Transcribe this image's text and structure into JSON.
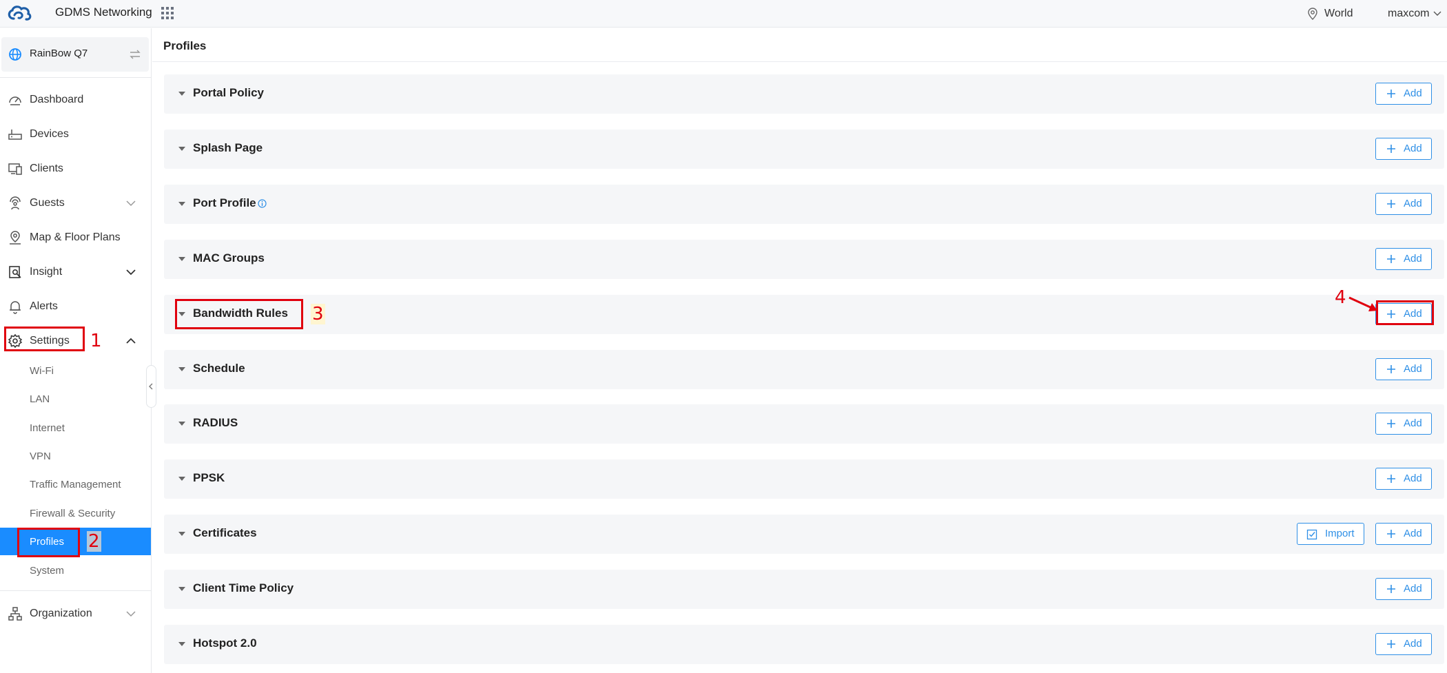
{
  "header": {
    "app_title": "GDMS Networking",
    "location": "World",
    "user": "maxcom"
  },
  "sidebar": {
    "site_name": "RainBow Q7",
    "items": [
      {
        "label": "Dashboard"
      },
      {
        "label": "Devices"
      },
      {
        "label": "Clients"
      },
      {
        "label": "Guests"
      },
      {
        "label": "Map & Floor Plans"
      },
      {
        "label": "Insight"
      },
      {
        "label": "Alerts"
      },
      {
        "label": "Settings"
      },
      {
        "label": "Organization"
      }
    ],
    "settings_sub": [
      {
        "label": "Wi-Fi"
      },
      {
        "label": "LAN"
      },
      {
        "label": "Internet"
      },
      {
        "label": "VPN"
      },
      {
        "label": "Traffic Management"
      },
      {
        "label": "Firewall & Security"
      },
      {
        "label": "Profiles"
      },
      {
        "label": "System"
      }
    ]
  },
  "main": {
    "title": "Profiles",
    "add_label": "Add",
    "import_label": "Import",
    "sections": [
      {
        "title": "Portal Policy"
      },
      {
        "title": "Splash Page"
      },
      {
        "title": "Port Profile"
      },
      {
        "title": "MAC Groups"
      },
      {
        "title": "Bandwidth Rules"
      },
      {
        "title": "Schedule"
      },
      {
        "title": "RADIUS"
      },
      {
        "title": "PPSK"
      },
      {
        "title": "Certificates"
      },
      {
        "title": "Client Time Policy"
      },
      {
        "title": "Hotspot 2.0"
      }
    ]
  },
  "annotations": {
    "step1": "1",
    "step2": "2",
    "step3": "3",
    "step4": "4"
  },
  "colors": {
    "accent": "#1a8cff",
    "button_border": "#2e8fe6",
    "annotation": "#e0000e"
  }
}
